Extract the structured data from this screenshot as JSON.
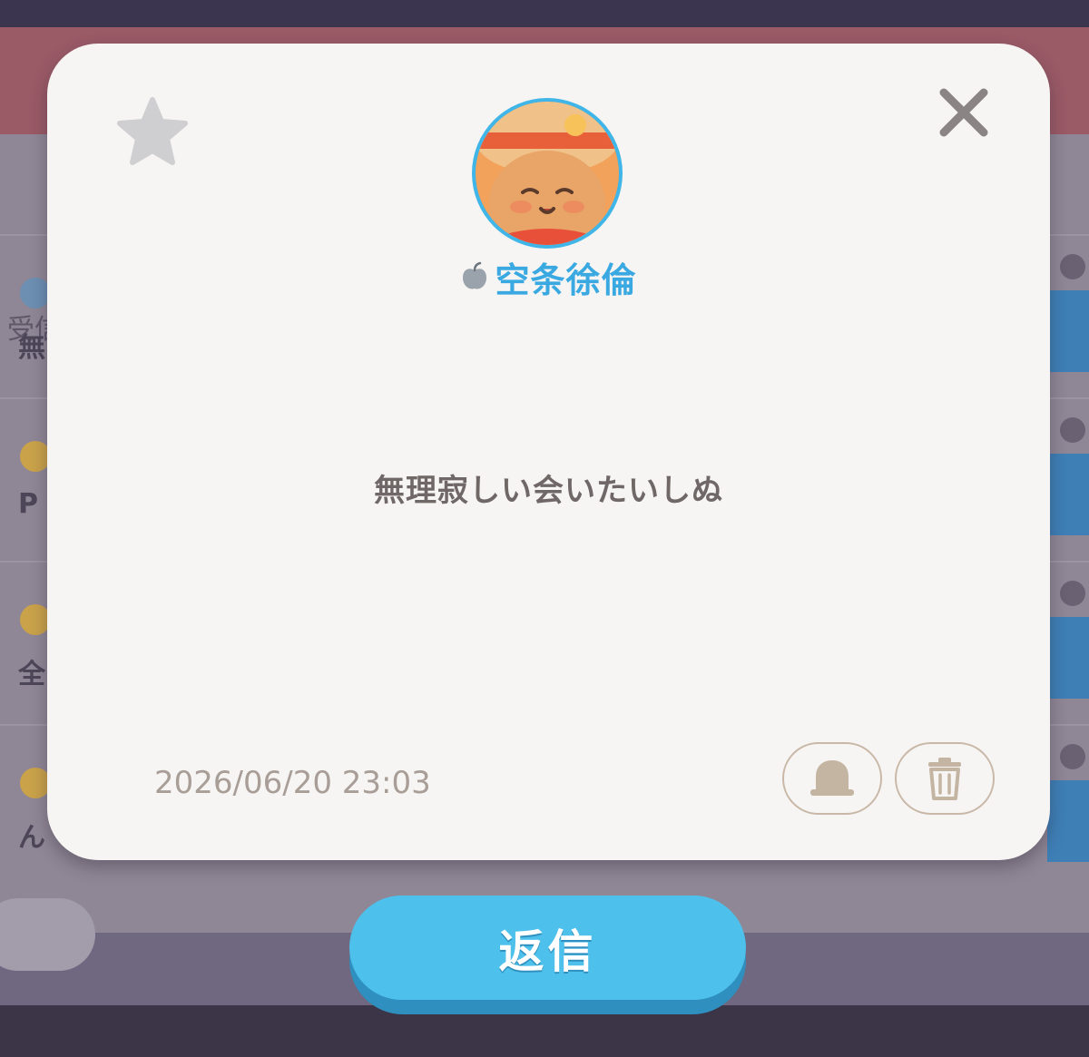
{
  "background": {
    "tab_label": "受信",
    "rows": [
      {
        "text": "無"
      },
      {
        "text": "P"
      },
      {
        "text": "全"
      },
      {
        "text": "ん"
      }
    ]
  },
  "modal": {
    "sender": {
      "name": "空条徐倫",
      "badge_icon": "apple-icon"
    },
    "message": "無理寂しい会いたいしぬ",
    "timestamp": "2026/06/20 23:03",
    "icons": {
      "favorite": "star-icon",
      "close": "close-icon",
      "report": "bell-icon",
      "delete": "trash-icon"
    }
  },
  "reply_button": {
    "label": "返信"
  },
  "colors": {
    "modal_bg": "#f6f5f3",
    "accent_blue": "#4ec0ec",
    "name_blue": "#3aa9e2",
    "text_muted": "#a89e97"
  }
}
